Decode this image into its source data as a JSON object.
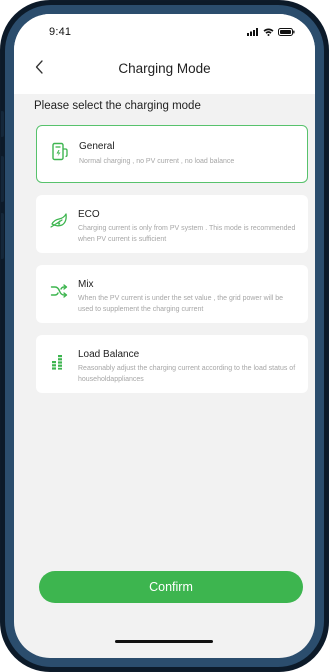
{
  "status_bar": {
    "time": "9:41",
    "icons": [
      "signal-icon",
      "wifi-icon",
      "battery-icon"
    ]
  },
  "nav": {
    "title": "Charging Mode",
    "back_icon": "chevron-left-icon"
  },
  "section_label": "Please select the charging mode",
  "modes": [
    {
      "title": "General",
      "description": "Normal charging , no PV current , no load balance",
      "icon": "charger-icon",
      "selected": true
    },
    {
      "title": "ECO",
      "description": "Charging current is only from PV system . This mode is recommended when PV current is sufficient",
      "icon": "leaf-icon",
      "selected": false
    },
    {
      "title": "Mix",
      "description": "When the PV current is under the set value ,  the grid power will be used to supplement the charging current",
      "icon": "shuffle-icon",
      "selected": false
    },
    {
      "title": "Load Balance",
      "description": "Reasonably adjust the charging current according to the load status of householdappliances",
      "icon": "bars-icon",
      "selected": false
    }
  ],
  "confirm_label": "Confirm",
  "colors": {
    "accent": "#3db54f",
    "selected_border": "#57c26c",
    "background": "#f2f2f2",
    "frame": "#0c1a29"
  }
}
